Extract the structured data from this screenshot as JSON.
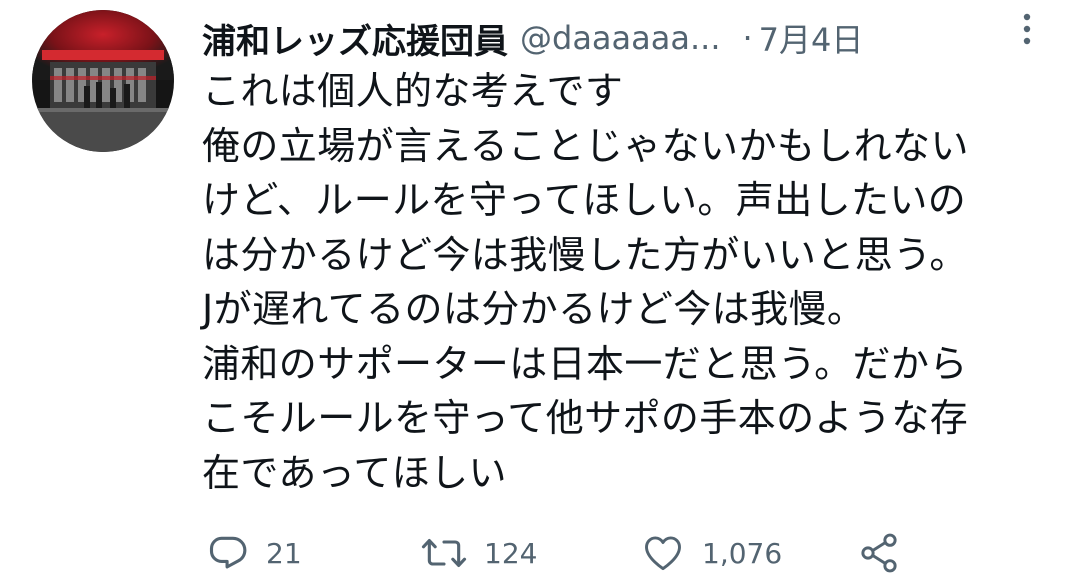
{
  "tweet": {
    "display_name": "浦和レッズ応援団員",
    "handle": "@daaaaaa...",
    "separator": "·",
    "date": "7月4日",
    "lines": [
      "これは個人的な考えです",
      "俺の立場が言えることじゃないかもしれない",
      "けど、ルールを守ってほしい。声出したいの",
      "は分かるけど今は我慢した方がいいと思う。",
      "Jが遅れてるのは分かるけど今は我慢。",
      "浦和のサポーターは日本一だと思う。だから",
      "こそルールを守って他サポの手本のような存",
      "在であってほしい"
    ]
  },
  "actions": {
    "reply_count": "21",
    "retweet_count": "124",
    "like_count": "1,076"
  },
  "icons": {
    "more": "more-vertical-icon",
    "reply": "reply-icon",
    "retweet": "retweet-icon",
    "like": "heart-icon",
    "share": "share-icon"
  },
  "colors": {
    "text": "#0f1419",
    "secondary": "#536471",
    "icon": "#536471"
  }
}
